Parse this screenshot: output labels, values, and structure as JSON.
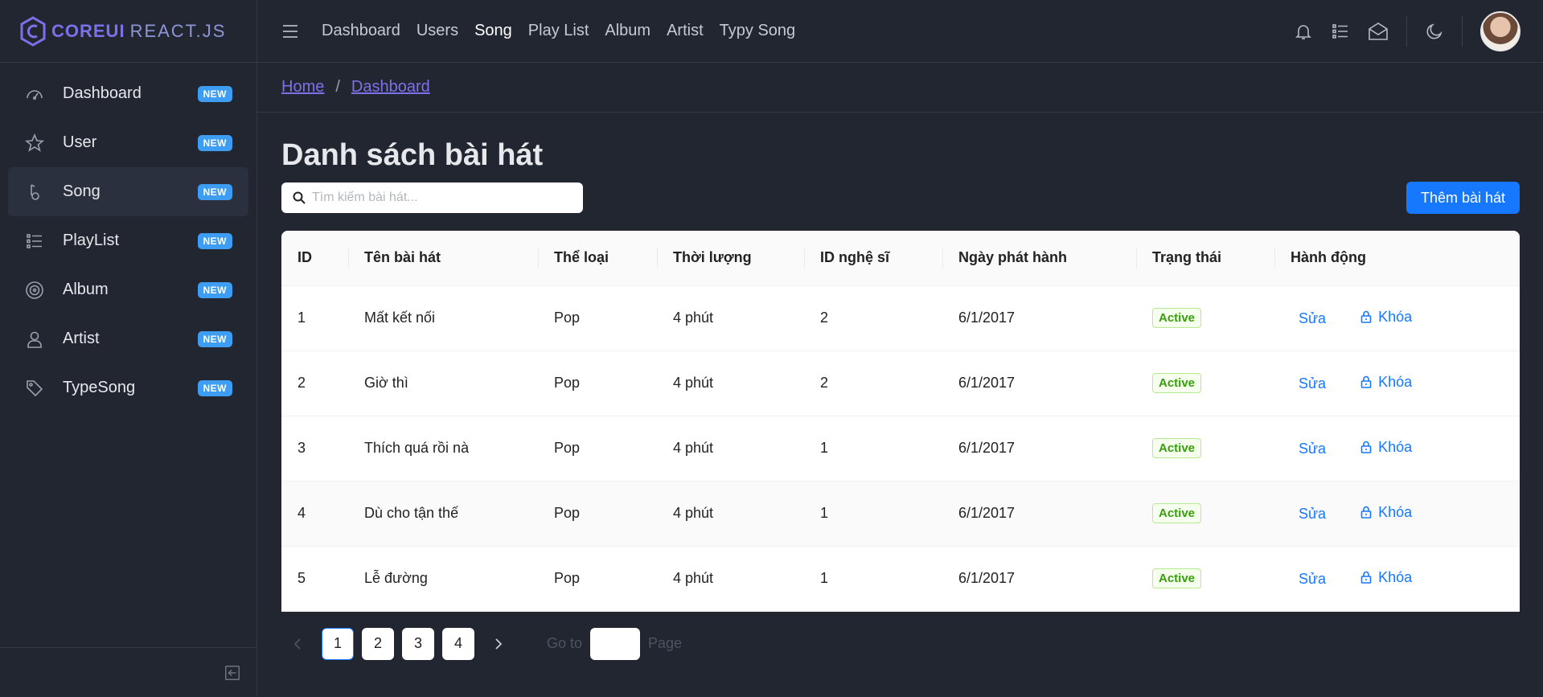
{
  "brand": {
    "core": "COREUI",
    "react": "REACT.JS"
  },
  "sidebar": {
    "badge": "NEW",
    "items": [
      {
        "label": "Dashboard",
        "icon": "speedometer-icon"
      },
      {
        "label": "User",
        "icon": "star-icon"
      },
      {
        "label": "Song",
        "icon": "music-note-icon",
        "active": true
      },
      {
        "label": "PlayList",
        "icon": "list-icon"
      },
      {
        "label": "Album",
        "icon": "disc-icon"
      },
      {
        "label": "Artist",
        "icon": "user-icon"
      },
      {
        "label": "TypeSong",
        "icon": "tag-icon"
      }
    ]
  },
  "topnav": [
    "Dashboard",
    "Users",
    "Song",
    "Play List",
    "Album",
    "Artist",
    "Typy Song"
  ],
  "breadcrumb": {
    "home": "Home",
    "current": "Dashboard"
  },
  "page": {
    "title": "Danh sách bài hát",
    "search_placeholder": "Tìm kiếm bài hát...",
    "add_button": "Thêm bài hát"
  },
  "table": {
    "headers": [
      "ID",
      "Tên bài hát",
      "Thể loại",
      "Thời lượng",
      "ID nghệ sĩ",
      "Ngày phát hành",
      "Trạng thái",
      "Hành động"
    ],
    "edit_label": "Sửa",
    "lock_label": "Khóa",
    "rows": [
      {
        "id": "1",
        "name": "Mất kết nối",
        "genre": "Pop",
        "duration": "4 phút",
        "artist_id": "2",
        "release": "6/1/2017",
        "status": "Active"
      },
      {
        "id": "2",
        "name": "Giờ thì",
        "genre": "Pop",
        "duration": "4 phút",
        "artist_id": "2",
        "release": "6/1/2017",
        "status": "Active"
      },
      {
        "id": "3",
        "name": "Thích quá rồi nà",
        "genre": "Pop",
        "duration": "4 phút",
        "artist_id": "1",
        "release": "6/1/2017",
        "status": "Active"
      },
      {
        "id": "4",
        "name": "Dù cho tận thế",
        "genre": "Pop",
        "duration": "4 phút",
        "artist_id": "1",
        "release": "6/1/2017",
        "status": "Active"
      },
      {
        "id": "5",
        "name": "Lễ đường",
        "genre": "Pop",
        "duration": "4 phút",
        "artist_id": "1",
        "release": "6/1/2017",
        "status": "Active"
      }
    ]
  },
  "pagination": {
    "pages": [
      "1",
      "2",
      "3",
      "4"
    ],
    "current": "1",
    "goto_label": "Go to",
    "page_label": "Page"
  },
  "colors": {
    "background": "#212631",
    "accent": "#7b72e9",
    "primary": "#1677ff",
    "badge": "#3d9df3",
    "status_green": "#389e0d"
  }
}
